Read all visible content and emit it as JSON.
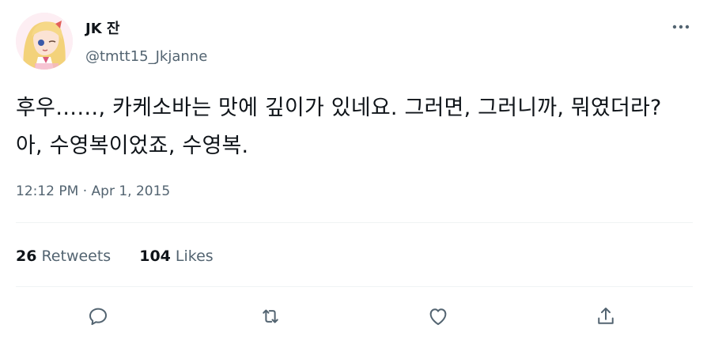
{
  "tweet": {
    "author": {
      "display_name": "JK 잔",
      "handle": "@tmtt15_Jkjanne"
    },
    "text": "후우……, 카케소바는 맛에 깊이가 있네요. 그러면, 그러니까, 뭐였더라? 아, 수영복이었죠, 수영복.",
    "timestamp": "12:12 PM · Apr 1, 2015",
    "stats": {
      "retweets_count": "26",
      "retweets_label": "Retweets",
      "likes_count": "104",
      "likes_label": "Likes"
    },
    "icons": {
      "more": "more-icon",
      "reply": "reply-icon",
      "retweet": "retweet-icon",
      "like": "like-icon",
      "share": "share-icon"
    },
    "colors": {
      "text_primary": "#0f1419",
      "text_secondary": "#536471",
      "divider": "#eff3f4"
    }
  }
}
